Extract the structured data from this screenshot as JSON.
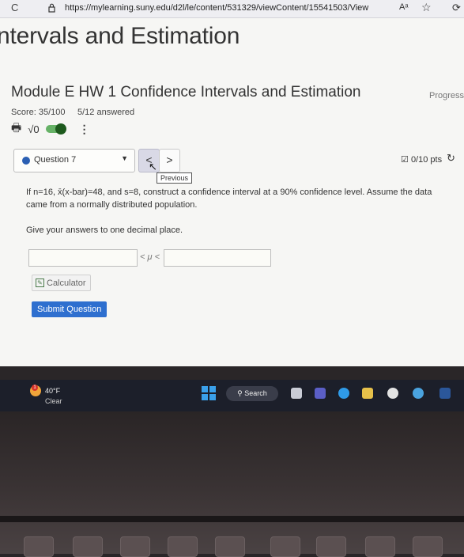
{
  "browser": {
    "url": "https://mylearning.suny.edu/d2l/le/content/531329/viewContent/15541503/View",
    "reload_glyph": "C",
    "reader_glyph": "Aᵃ"
  },
  "page": {
    "course_title": "ntervals and Estimation",
    "hw_title": "Module E HW 1 Confidence Intervals and Estimation",
    "progress_label": "Progress",
    "score": "Score: 35/100",
    "answered": "5/12 answered",
    "sqrt_label": "√0",
    "question_select": "Question 7",
    "prev_glyph": "<",
    "next_glyph": ">",
    "tooltip": "Previous",
    "points": "0/10 pts",
    "question_text": "If n=16, x̄(x-bar)=48, and s=8, construct a confidence interval at a 90% confidence level. Assume the data came from a normally distributed population.",
    "instruction": "Give your answers to one decimal place.",
    "answer_lower": "",
    "answer_upper": "",
    "mu_symbol": "< μ <",
    "calculator_label": "Calculator",
    "submit_label": "Submit Question",
    "accent_color": "#2e6fcf"
  },
  "taskbar": {
    "temperature": "40°F",
    "condition": "Clear",
    "weather_badge": "1",
    "search_label": "Search"
  }
}
